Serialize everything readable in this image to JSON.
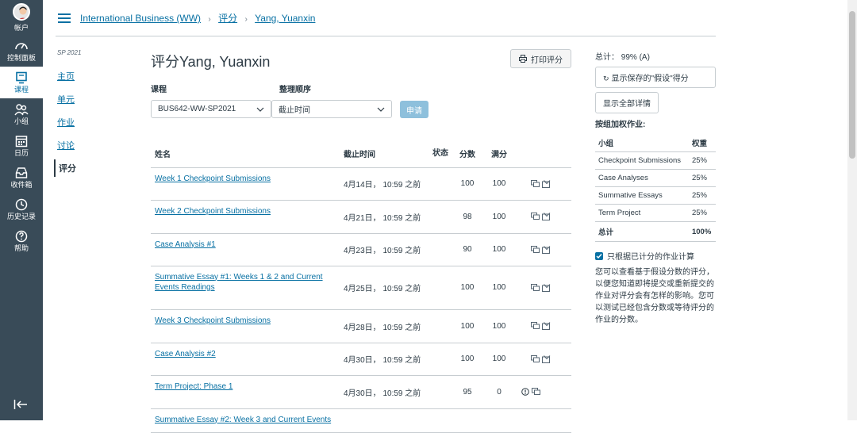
{
  "global_nav": {
    "items": [
      {
        "label": "帐户"
      },
      {
        "label": "控制面板"
      },
      {
        "label": "课程"
      },
      {
        "label": "小组"
      },
      {
        "label": "日历"
      },
      {
        "label": "收件箱"
      },
      {
        "label": "历史记录"
      },
      {
        "label": "帮助"
      }
    ]
  },
  "breadcrumb": {
    "course": "International Business (WW)",
    "section": "评分",
    "student": "Yang, Yuanxin"
  },
  "course_nav": {
    "term": "SP 2021",
    "items": [
      {
        "label": "主页"
      },
      {
        "label": "单元"
      },
      {
        "label": "作业"
      },
      {
        "label": "讨论"
      },
      {
        "label": "评分"
      }
    ]
  },
  "main": {
    "title": "评分Yang, Yuanxin",
    "print_button": "打印评分",
    "course_label": "课程",
    "course_value": "BUS642-WW-SP2021",
    "sort_label": "整理顺序",
    "sort_value": "截止时间",
    "apply_button": "申请"
  },
  "table": {
    "headers": {
      "name": "姓名",
      "due": "截止时间",
      "status": "状态",
      "score": "分数",
      "total": "满分"
    },
    "rows": [
      {
        "name": "Week 1 Checkpoint Submissions",
        "due": "4月14日， 10:59 之前",
        "score": "100",
        "total": "100",
        "icons": [
          "comment-icon",
          "rubric-icon"
        ]
      },
      {
        "name": "Week 2 Checkpoint Submissions",
        "due": "4月21日， 10:59 之前",
        "score": "98",
        "total": "100",
        "icons": [
          "comment-icon",
          "rubric-icon"
        ]
      },
      {
        "name": "Case Analysis #1",
        "due": "4月23日， 10:59 之前",
        "score": "90",
        "total": "100",
        "icons": [
          "comment-icon",
          "rubric-icon"
        ]
      },
      {
        "name": "Summative Essay #1: Weeks 1 & 2 and Current Events Readings",
        "due": "4月25日， 10:59 之前",
        "score": "100",
        "total": "100",
        "icons": [
          "comment-icon",
          "rubric-icon"
        ]
      },
      {
        "name": "Week 3 Checkpoint Submissions",
        "due": "4月28日， 10:59 之前",
        "score": "100",
        "total": "100",
        "icons": [
          "comment-icon",
          "rubric-icon"
        ]
      },
      {
        "name": "Case Analysis #2",
        "due": "4月30日， 10:59 之前",
        "score": "100",
        "total": "100",
        "icons": [
          "comment-icon",
          "rubric-icon"
        ]
      },
      {
        "name": "Term Project: Phase 1",
        "due": "4月30日， 10:59 之前",
        "score": "95",
        "total": "0",
        "icons": [
          "alert-icon",
          "comment-icon"
        ]
      },
      {
        "name": "Summative Essay #2: Week 3 and Current Events",
        "due": "",
        "score": "",
        "total": "",
        "icons": []
      }
    ]
  },
  "sidebar": {
    "total": "总计： 99% (A)",
    "whatif_button": "显示保存的\"假设\"得分",
    "show_all_button": "显示全部详情",
    "weights_title": "按组加权作业:",
    "weights_header": {
      "group": "小组",
      "weight": "权重"
    },
    "weights": [
      {
        "group": "Checkpoint Submissions",
        "weight": "25%"
      },
      {
        "group": "Case Analyses",
        "weight": "25%"
      },
      {
        "group": "Summative Essays",
        "weight": "25%"
      },
      {
        "group": "Term Project",
        "weight": "25%"
      },
      {
        "group": "总计",
        "weight": "100%"
      }
    ],
    "checkbox_label": "只根据已计分的作业计算",
    "note": "您可以查看基于假设分数的评分，以便您知道即将提交或重新提交的作业对评分会有怎样的影响。您可以测试已经包含分数或等待评分的作业的分数。"
  }
}
